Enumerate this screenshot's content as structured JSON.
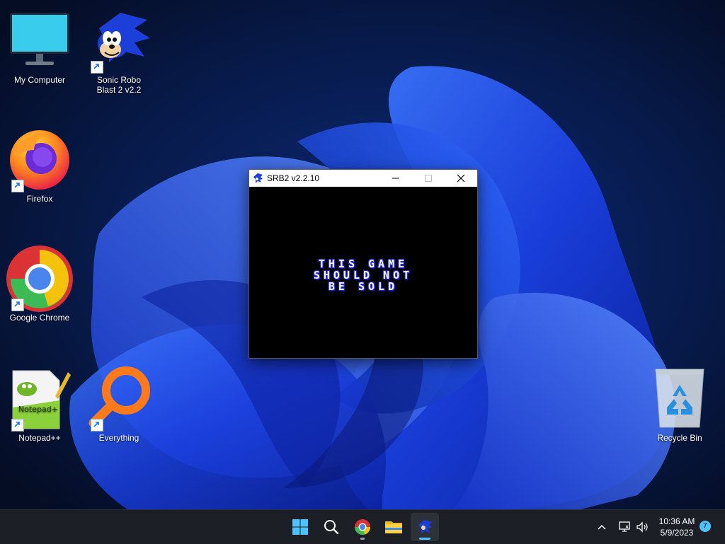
{
  "desktop": {
    "icons": [
      {
        "label": "My Computer"
      },
      {
        "label": "Sonic Robo Blast 2 v2.2"
      },
      {
        "label": "Firefox"
      },
      {
        "label": "Google Chrome"
      },
      {
        "label": "Notepad++"
      },
      {
        "label": "Everything"
      },
      {
        "label": "Recycle Bin"
      }
    ]
  },
  "window": {
    "title": "SRB2 v2.2.10",
    "screen_text": [
      "THIS GAME",
      "SHOULD NOT",
      "BE SOLD"
    ]
  },
  "taskbar": {
    "items": [
      {
        "icon": "windows-start-icon"
      },
      {
        "icon": "search-icon"
      },
      {
        "icon": "chrome-icon"
      },
      {
        "icon": "file-explorer-icon"
      },
      {
        "icon": "srb2-icon"
      }
    ],
    "clock": {
      "time": "10:36 AM",
      "date": "5/9/2023"
    },
    "notifications": "7"
  },
  "colors": {
    "accent": "#4cc2ff",
    "wallpaper_bloom": "#1f4fff"
  }
}
